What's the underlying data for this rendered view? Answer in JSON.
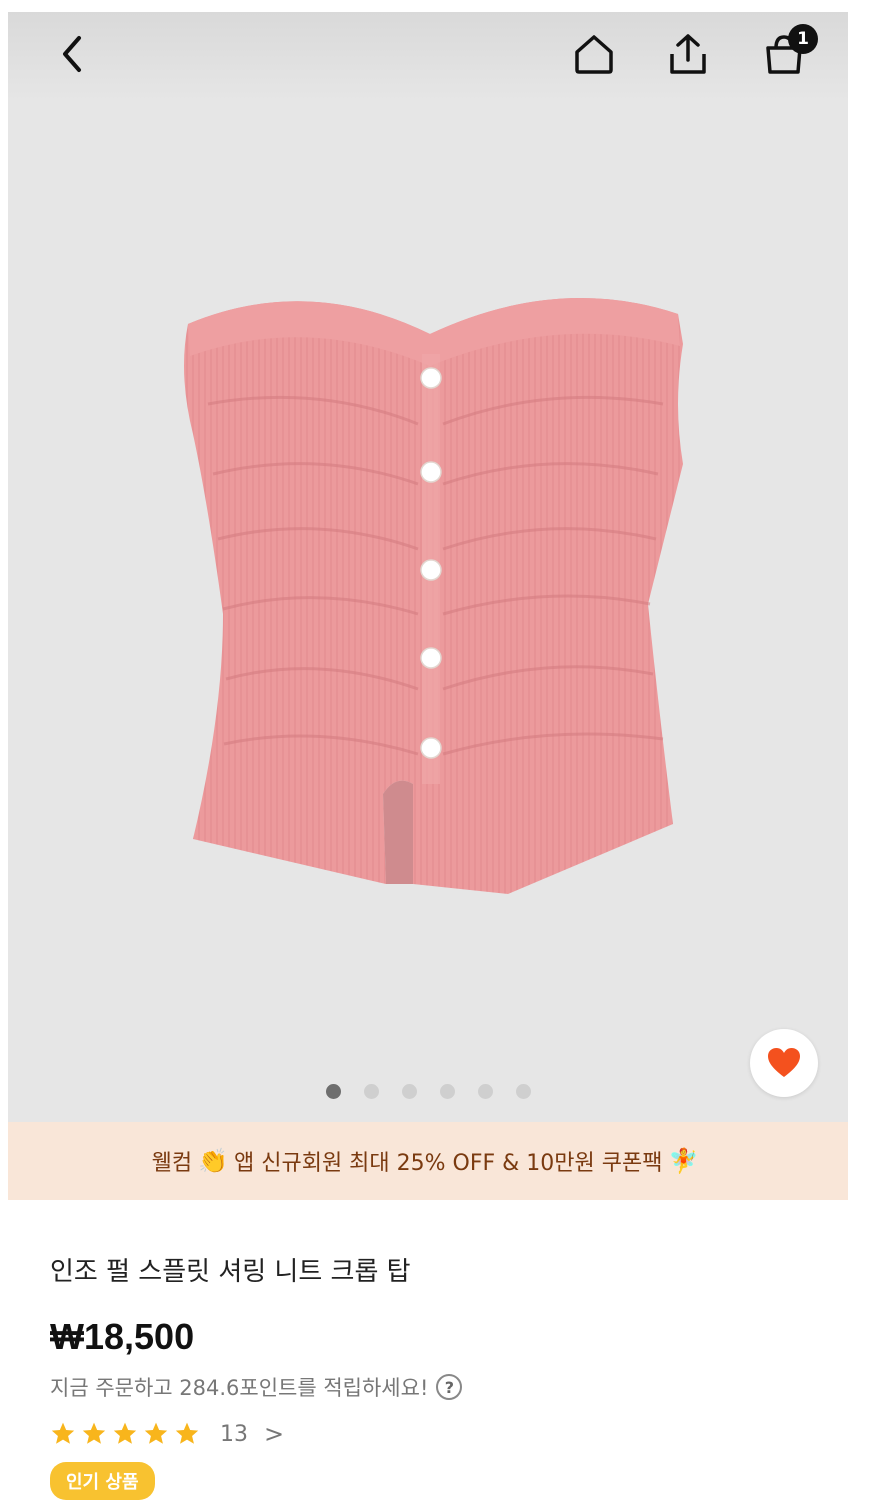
{
  "header": {
    "cart_count": "1",
    "icons": [
      "chevron-left-icon",
      "home-icon",
      "share-icon",
      "shopping-bag-icon"
    ]
  },
  "gallery": {
    "image_count": 6,
    "active_index": 0,
    "favorite": true,
    "favorite_color": "#f4511e"
  },
  "promo": {
    "text_before": "웰컴",
    "emoji_clap": "👏",
    "text_after": "앱 신규회원 최대 25% OFF & 10만원 쿠폰팩",
    "emoji_fairy": "🧚"
  },
  "product": {
    "title": "인조 펄 스플릿 셔링 니트 크롭 탑",
    "price": "₩18,500",
    "points_text": "지금 주문하고 284.6포인트를 적립하세요!",
    "help_symbol": "?",
    "rating": 5,
    "review_count": "13",
    "chevron": ">",
    "tag": "인기 상품"
  },
  "colors": {
    "accent_star": "#f8b51c",
    "tag_bg": "#f8c230",
    "promo_bg": "#f9e6d8",
    "product_pink": "#ec9a9c"
  }
}
